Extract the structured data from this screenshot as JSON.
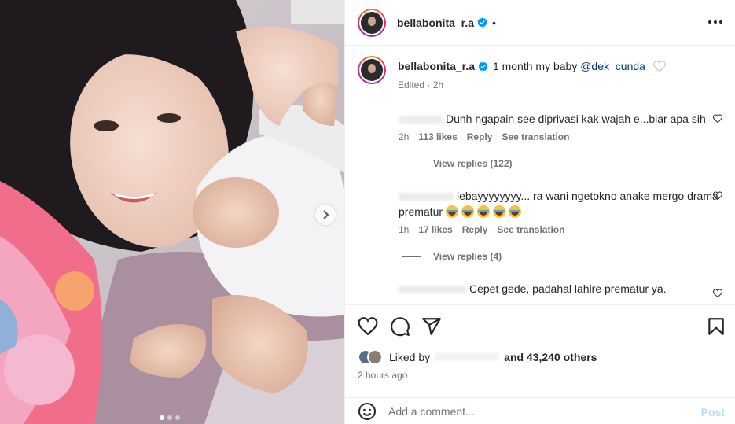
{
  "post": {
    "username": "bellabonita_r.a",
    "header_separator": "•",
    "caption_text": "1 month my baby",
    "caption_mention": "@dek_cunda",
    "caption_meta": "Edited · 2h",
    "carousel_dots": 3,
    "carousel_active_index": 0
  },
  "comments": [
    {
      "text": "Duhh ngapain see diprivasi kak wajah e...biar apa sih",
      "time": "2h",
      "likes": "113 likes",
      "reply": "Reply",
      "translate": "See translation",
      "view_replies": "View replies (122)"
    },
    {
      "text": "lebayyyyyyyy... ra wani ngetokno anake mergo drama prematur",
      "emoji_count": 5,
      "time": "1h",
      "likes": "17 likes",
      "reply": "Reply",
      "translate": "See translation",
      "view_replies": "View replies (4)"
    },
    {
      "text": "Cepet gede, padahal lahire prematur ya."
    }
  ],
  "likes": {
    "liked_by": "Liked by",
    "and_others": "and 43,240 others",
    "time_ago": "2 hours ago"
  },
  "composer": {
    "placeholder": "Add a comment...",
    "post_label": "Post"
  },
  "icons": [
    "heart-icon",
    "comment-icon",
    "share-icon",
    "bookmark-icon",
    "emoji-icon",
    "more-icon",
    "verified-icon",
    "chevron-right-icon"
  ],
  "colors": {
    "verified": "#0095f6",
    "mention": "#00376b",
    "post_disabled": "#b3dbff",
    "secondary_text": "#737373"
  }
}
